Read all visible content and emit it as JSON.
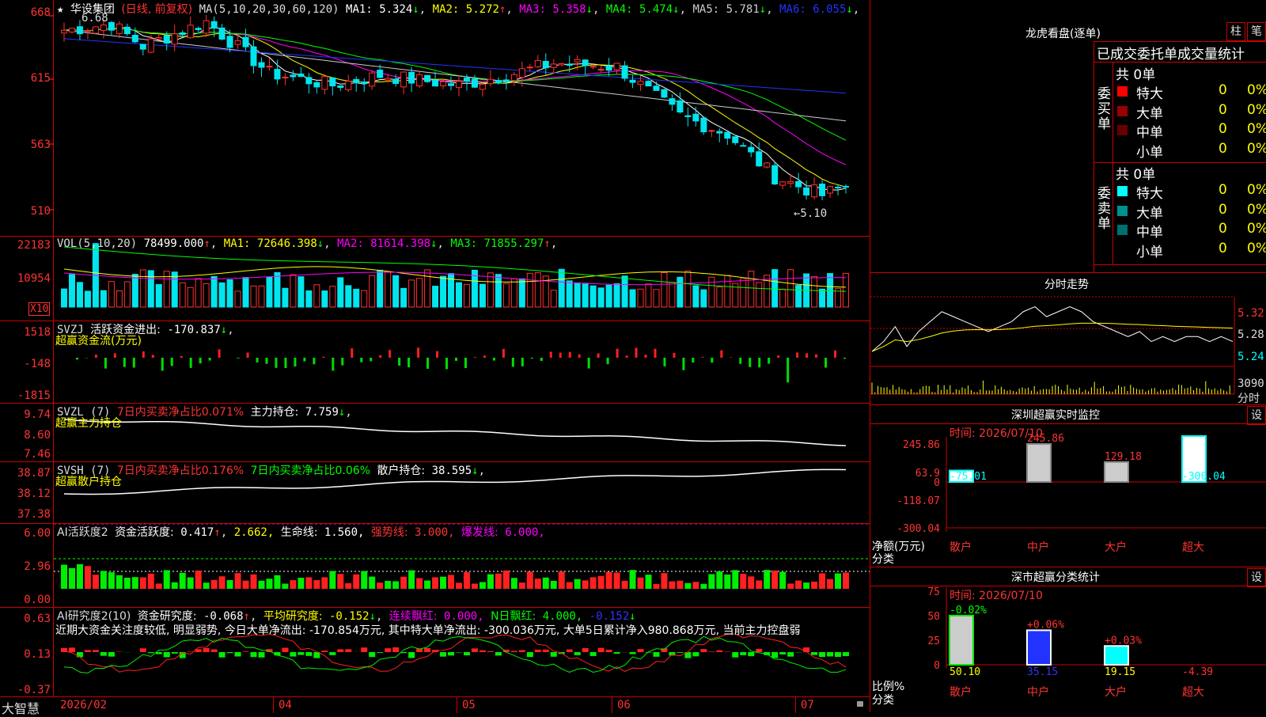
{
  "stock": {
    "name": "华设集团",
    "mode": "(日线, 前复权)",
    "star": "★"
  },
  "kline": {
    "ma_header": "MA(5,10,20,30,60,120)",
    "ma": [
      {
        "label": "MA1:",
        "value": "5.324",
        "arrow": "↓",
        "color": "#ffffff"
      },
      {
        "label": "MA2:",
        "value": "5.272",
        "arrow": "↑",
        "color": "#ffff00"
      },
      {
        "label": "MA3:",
        "value": "5.358",
        "arrow": "↓",
        "color": "#ff00ff"
      },
      {
        "label": "MA4:",
        "value": "5.474",
        "arrow": "↓",
        "color": "#00ff00"
      },
      {
        "label": "MA5:",
        "value": "5.781",
        "arrow": "↓",
        "color": "#cccccc"
      },
      {
        "label": "MA6:",
        "value": "6.055",
        "arrow": "↓",
        "color": "#2233ff"
      }
    ],
    "y_labels": [
      "668",
      "615",
      "563",
      "510"
    ],
    "high_label": "6.68",
    "low_label": "←5.10"
  },
  "vol": {
    "header": "VOL(5,10,20)",
    "value": "78499.000",
    "value_arrow": "↑",
    "ma": [
      {
        "label": "MA1:",
        "value": "72646.398",
        "arrow": "↓",
        "color": "#ffff00"
      },
      {
        "label": "MA2:",
        "value": "81614.398",
        "arrow": "↓",
        "color": "#ff00ff"
      },
      {
        "label": "MA3:",
        "value": "71855.297",
        "arrow": "↑",
        "color": "#00ff00"
      }
    ],
    "y_labels": [
      "22183",
      "10954"
    ],
    "unit": "X10"
  },
  "svzj": {
    "title": "SVZJ",
    "label": "活跃资金进出:",
    "value": "-170.837",
    "arrow": "↓",
    "tail": ",",
    "subtitle": "超赢资金流(万元)",
    "y_labels": [
      "1518",
      "-148",
      "-1815"
    ]
  },
  "svzl": {
    "title": "SVZL (7)",
    "p1": "7日内买卖净占比0.071%",
    "p2": "主力持仓:",
    "value": "7.759",
    "arrow": "↓",
    "tail": ",",
    "subtitle": "超赢主力持仓",
    "y_labels": [
      "9.74",
      "8.60",
      "7.46"
    ]
  },
  "svsh": {
    "title": "SVSH (7)",
    "p1": "7日内买卖净占比0.176%",
    "p2": "7日内买卖净占比0.06%",
    "p3": "散户持仓:",
    "value": "38.595",
    "arrow": "↓",
    "tail": ",",
    "subtitle": "超赢散户持仓",
    "y_labels": [
      "38.87",
      "38.12",
      "37.38"
    ]
  },
  "ai1": {
    "title": "AI活跃度2",
    "l1": "资金活跃度:",
    "v1": "0.417",
    "v2": "2.662,",
    "l3": "生命线:",
    "v3": "1.560,",
    "l4": "强势线:",
    "v4": "3.000,",
    "l5": "爆发线:",
    "v5": "6.000,",
    "y_labels": [
      "6.00",
      "2.96",
      "0.00"
    ]
  },
  "ai2": {
    "title": "AI研究度2(10)",
    "l1": "资金研究度:",
    "v1": "-0.068",
    "l2": "平均研究度:",
    "v2": "-0.152",
    "l3": "连续飘红:",
    "v3": "0.000,",
    "l4": "N日飘红:",
    "v4": "4.000,",
    "v5": "-0.152",
    "text": "近期大资金关注度较低, 明显弱势, 今日大单净流出: -170.854万元, 其中特大单净流出: -300.036万元, 大单5日累计净入980.868万元, 当前主力控盘弱",
    "y_labels": [
      "0.63",
      "0.13",
      "-0.37"
    ]
  },
  "xaxis": {
    "labels": [
      "2026/02",
      "04",
      "05",
      "06",
      "07"
    ],
    "logo": "大智慧"
  },
  "dragon": {
    "title": "龙虎看盘(逐单)",
    "btn1": "柱",
    "btn2": "笔",
    "subtitle": "已成交委托单成交量统计",
    "buy": {
      "side": "委买单",
      "total": "共 0单",
      "rows": [
        {
          "name": "特大",
          "count": "0",
          "pct": "0%",
          "color": "#ff0000"
        },
        {
          "name": "大单",
          "count": "0",
          "pct": "0%",
          "color": "#990000"
        },
        {
          "name": "中单",
          "count": "0",
          "pct": "0%",
          "color": "#660000"
        },
        {
          "name": "小单",
          "count": "0",
          "pct": "0%",
          "color": ""
        }
      ]
    },
    "sell": {
      "side": "委卖单",
      "total": "共 0单",
      "rows": [
        {
          "name": "特大",
          "count": "0",
          "pct": "0%",
          "color": "#00ffff"
        },
        {
          "name": "大单",
          "count": "0",
          "pct": "0%",
          "color": "#008f8f"
        },
        {
          "name": "中单",
          "count": "0",
          "pct": "0%",
          "color": "#006f6f"
        },
        {
          "name": "小单",
          "count": "0",
          "pct": "0%",
          "color": ""
        }
      ]
    }
  },
  "intraday": {
    "title": "分时走势",
    "prices": [
      "5.32",
      "5.28",
      "5.24"
    ],
    "vol_top": "3090",
    "vol_unit": "分时"
  },
  "monitor": {
    "title": "深圳超赢实时监控",
    "btn": "设",
    "time": "时间: 2026/07/10",
    "y_labels": [
      "245.86",
      "63.9",
      "0",
      "-118.07",
      "-300.04"
    ],
    "ylabel": "净额(万元)",
    "xlabel": "分类",
    "categories": [
      "散户",
      "中户",
      "大户",
      "超大"
    ],
    "values": [
      "-75.01",
      "245.86",
      "129.18",
      "-300.04"
    ]
  },
  "stats": {
    "title": "深市超赢分类统计",
    "btn": "设",
    "time": "时间: 2026/07/10",
    "y_labels": [
      "75",
      "50",
      "25",
      "0"
    ],
    "ylabel": "比例%",
    "xlabel": "分类",
    "categories": [
      "散户",
      "中户",
      "大户",
      "超大"
    ],
    "bottom_values": [
      "50.10",
      "35.15",
      "19.15",
      "-4.39"
    ],
    "top_values": [
      "-0.02%",
      "+0.06%",
      "+0.03%",
      ""
    ]
  },
  "chart_data": [
    {
      "type": "line",
      "name": "intraday-price",
      "values": [
        5.25,
        5.27,
        5.3,
        5.26,
        5.29,
        5.31,
        5.33,
        5.32,
        5.31,
        5.3,
        5.29,
        5.3,
        5.31,
        5.33,
        5.34,
        5.32,
        5.33,
        5.34,
        5.33,
        5.31,
        5.3,
        5.29,
        5.28,
        5.29,
        5.27,
        5.28,
        5.27,
        5.28,
        5.28,
        5.27,
        5.28,
        5.27
      ]
    },
    {
      "type": "bar",
      "name": "monitor",
      "categories": [
        "散户",
        "中户",
        "大户",
        "超大"
      ],
      "values": [
        -75.01,
        245.86,
        129.18,
        -300.04
      ],
      "ylim": [
        -300.04,
        245.86
      ]
    },
    {
      "type": "bar",
      "name": "stats",
      "categories": [
        "散户",
        "中户",
        "大户",
        "超大"
      ],
      "values": [
        50.1,
        35.15,
        19.15,
        -4.39
      ],
      "ylim": [
        0,
        75
      ]
    }
  ]
}
